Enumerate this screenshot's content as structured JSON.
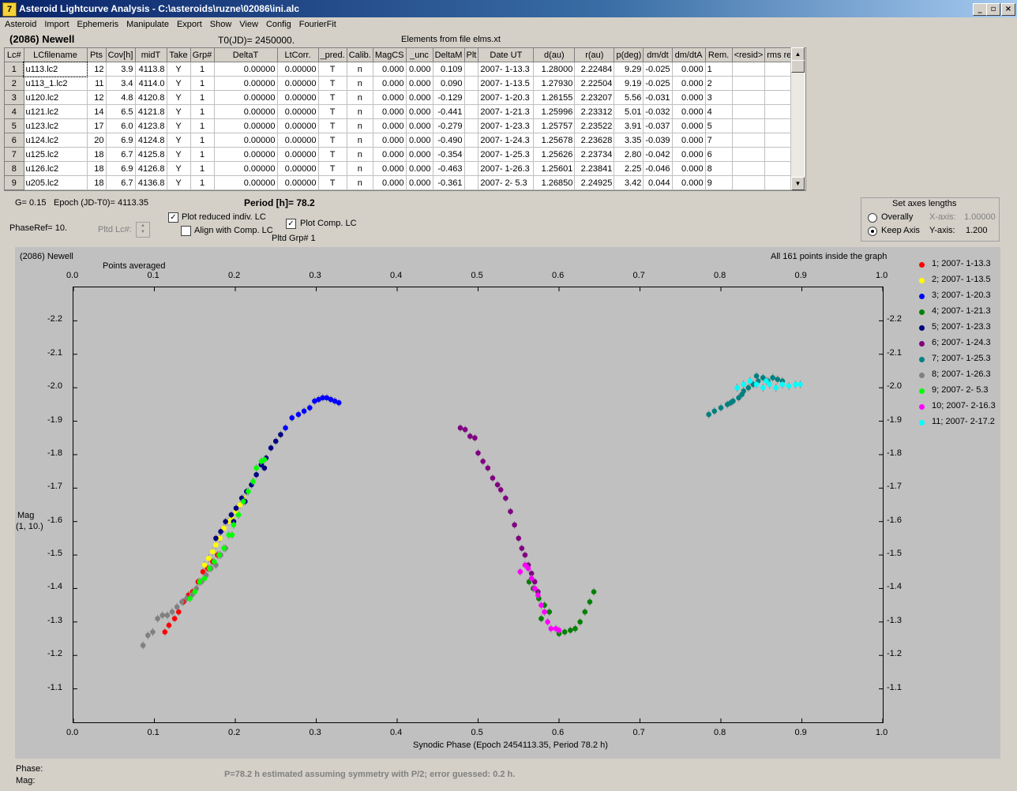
{
  "window": {
    "title": "Asteroid Lightcurve Analysis - C:\\asteroids\\ruzne\\02086\\ini.alc",
    "app_icon": "7",
    "minimize": "_",
    "maximize": "▫",
    "close": "×"
  },
  "menu": [
    "Asteroid",
    "Import",
    "Ephemeris",
    "Manipulate",
    "Export",
    "Show",
    "View",
    "Config",
    "FourierFit"
  ],
  "header": {
    "asteroid": "(2086) Newell",
    "t0": "T0(JD)= 2450000.",
    "elements": "Elements from file elms.xt"
  },
  "table": {
    "columns": [
      "Lc#",
      "LCfilename",
      "Pts",
      "Cov[h]",
      "midT",
      "Take",
      "Grp#",
      "DeltaT",
      "LtCorr.",
      "_pred.",
      "Calib.",
      "MagCS",
      "_unc",
      "DeltaM",
      "Plt",
      "Date UT",
      "d(au)",
      "r(au)",
      "p(deg)",
      "dm/dt",
      "dm/dtA",
      "Rem.",
      "<resid>",
      "rms res"
    ],
    "rows": [
      [
        "1",
        "u113.lc2",
        "12",
        "3.9",
        "4113.8",
        "Y",
        "1",
        "0.00000",
        "0.00000",
        "T",
        "n",
        "0.000",
        "0.000",
        "0.109",
        "",
        "2007- 1-13.3",
        "1.28000",
        "2.22484",
        "9.29",
        "-0.025",
        "0.000",
        "1",
        "",
        ""
      ],
      [
        "2",
        "u113_1.lc2",
        "11",
        "3.4",
        "4114.0",
        "Y",
        "1",
        "0.00000",
        "0.00000",
        "T",
        "n",
        "0.000",
        "0.000",
        "0.090",
        "",
        "2007- 1-13.5",
        "1.27930",
        "2.22504",
        "9.19",
        "-0.025",
        "0.000",
        "2",
        "",
        ""
      ],
      [
        "3",
        "u120.lc2",
        "12",
        "4.8",
        "4120.8",
        "Y",
        "1",
        "0.00000",
        "0.00000",
        "T",
        "n",
        "0.000",
        "0.000",
        "-0.129",
        "",
        "2007- 1-20.3",
        "1.26155",
        "2.23207",
        "5.56",
        "-0.031",
        "0.000",
        "3",
        "",
        ""
      ],
      [
        "4",
        "u121.lc2",
        "14",
        "6.5",
        "4121.8",
        "Y",
        "1",
        "0.00000",
        "0.00000",
        "T",
        "n",
        "0.000",
        "0.000",
        "-0.441",
        "",
        "2007- 1-21.3",
        "1.25996",
        "2.23312",
        "5.01",
        "-0.032",
        "0.000",
        "4",
        "",
        ""
      ],
      [
        "5",
        "u123.lc2",
        "17",
        "6.0",
        "4123.8",
        "Y",
        "1",
        "0.00000",
        "0.00000",
        "T",
        "n",
        "0.000",
        "0.000",
        "-0.279",
        "",
        "2007- 1-23.3",
        "1.25757",
        "2.23522",
        "3.91",
        "-0.037",
        "0.000",
        "5",
        "",
        ""
      ],
      [
        "6",
        "u124.lc2",
        "20",
        "6.9",
        "4124.8",
        "Y",
        "1",
        "0.00000",
        "0.00000",
        "T",
        "n",
        "0.000",
        "0.000",
        "-0.490",
        "",
        "2007- 1-24.3",
        "1.25678",
        "2.23628",
        "3.35",
        "-0.039",
        "0.000",
        "7",
        "",
        ""
      ],
      [
        "7",
        "u125.lc2",
        "18",
        "6.7",
        "4125.8",
        "Y",
        "1",
        "0.00000",
        "0.00000",
        "T",
        "n",
        "0.000",
        "0.000",
        "-0.354",
        "",
        "2007- 1-25.3",
        "1.25626",
        "2.23734",
        "2.80",
        "-0.042",
        "0.000",
        "6",
        "",
        ""
      ],
      [
        "8",
        "u126.lc2",
        "18",
        "6.9",
        "4126.8",
        "Y",
        "1",
        "0.00000",
        "0.00000",
        "T",
        "n",
        "0.000",
        "0.000",
        "-0.463",
        "",
        "2007- 1-26.3",
        "1.25601",
        "2.23841",
        "2.25",
        "-0.046",
        "0.000",
        "8",
        "",
        ""
      ],
      [
        "9",
        "u205.lc2",
        "18",
        "6.7",
        "4136.8",
        "Y",
        "1",
        "0.00000",
        "0.00000",
        "T",
        "n",
        "0.000",
        "0.000",
        "-0.361",
        "",
        "2007- 2- 5.3",
        "1.26850",
        "2.24925",
        "3.42",
        "0.044",
        "0.000",
        "9",
        "",
        ""
      ]
    ]
  },
  "controls": {
    "g": "G= 0.15",
    "epoch": "Epoch (JD-T0)= 4113.35",
    "period": "Period [h]= 78.2",
    "phaseref": "PhaseRef= 10.",
    "pltd_lc": "Pltd Lc#:",
    "plot_reduced": "Plot reduced indiv. LC",
    "align_comp": "Align with Comp. LC",
    "plot_comp": "Plot Comp. LC",
    "pltd_grp": "Pltd Grp#  1",
    "axes_title": "Set axes lengths",
    "overally": "Overally",
    "keep_axis": "Keep Axis",
    "x_axis_label": "X-axis:",
    "x_axis_value": "1.00000",
    "y_axis_label": "Y-axis:",
    "y_axis_value": "1.200",
    "checked": "✓"
  },
  "graph": {
    "title": "(2086) Newell",
    "top_note": "Points averaged",
    "points_note": "All 161 points inside the graph",
    "ylabel_line1": "Mag",
    "ylabel_line2": "(1, 10.)",
    "xlabel": "Synodic Phase (Epoch 2454113.35, Period 78.2 h)"
  },
  "status": {
    "phase": "Phase:",
    "mag": "Mag:",
    "message": "P=78.2 h estimated assuming symmetry with P/2; error guessed: 0.2 h."
  },
  "chart_data": {
    "type": "scatter",
    "xlim": [
      0.0,
      1.0
    ],
    "ylim": [
      -2.3,
      -1.0
    ],
    "y_inverted": true,
    "x_ticks": [
      "0.0",
      "0.1",
      "0.2",
      "0.3",
      "0.4",
      "0.5",
      "0.6",
      "0.7",
      "0.8",
      "0.9",
      "1.0"
    ],
    "y_ticks": [
      "-2.2",
      "-2.1",
      "-2.0",
      "-1.9",
      "-1.8",
      "-1.7",
      "-1.6",
      "-1.5",
      "-1.4",
      "-1.3",
      "-1.2",
      "-1.1"
    ],
    "legend_position": "right",
    "series": [
      {
        "name": "1; 2007- 1-13.3",
        "color": "#ff0000",
        "points": [
          [
            0.113,
            -1.27
          ],
          [
            0.118,
            -1.29
          ],
          [
            0.125,
            -1.31
          ],
          [
            0.13,
            -1.33
          ],
          [
            0.136,
            -1.36
          ],
          [
            0.142,
            -1.38
          ],
          [
            0.147,
            -1.39
          ],
          [
            0.154,
            -1.42
          ],
          [
            0.16,
            -1.45
          ],
          [
            0.166,
            -1.46
          ],
          [
            0.172,
            -1.48
          ],
          [
            0.178,
            -1.5
          ]
        ]
      },
      {
        "name": "2; 2007- 1-13.5",
        "color": "#ffff00",
        "points": [
          [
            0.162,
            -1.47
          ],
          [
            0.167,
            -1.49
          ],
          [
            0.172,
            -1.51
          ],
          [
            0.176,
            -1.53
          ],
          [
            0.181,
            -1.55
          ],
          [
            0.186,
            -1.58
          ],
          [
            0.191,
            -1.6
          ],
          [
            0.196,
            -1.61
          ],
          [
            0.201,
            -1.63
          ],
          [
            0.206,
            -1.65
          ],
          [
            0.21,
            -1.67
          ]
        ]
      },
      {
        "name": "3; 2007- 1-20.3",
        "color": "#0000ff",
        "points": [
          [
            0.262,
            -1.88
          ],
          [
            0.27,
            -1.91
          ],
          [
            0.278,
            -1.92
          ],
          [
            0.285,
            -1.93
          ],
          [
            0.292,
            -1.94
          ],
          [
            0.298,
            -1.96
          ],
          [
            0.303,
            -1.965
          ],
          [
            0.308,
            -1.97
          ],
          [
            0.313,
            -1.97
          ],
          [
            0.318,
            -1.965
          ],
          [
            0.323,
            -1.96
          ],
          [
            0.328,
            -1.955
          ]
        ]
      },
      {
        "name": "4; 2007- 1-21.3",
        "color": "#008000",
        "points": [
          [
            0.6,
            -1.265
          ],
          [
            0.607,
            -1.27
          ],
          [
            0.614,
            -1.275
          ],
          [
            0.62,
            -1.28
          ],
          [
            0.626,
            -1.3
          ],
          [
            0.632,
            -1.33
          ],
          [
            0.638,
            -1.36
          ],
          [
            0.643,
            -1.39
          ],
          [
            0.588,
            -1.33
          ],
          [
            0.582,
            -1.35
          ],
          [
            0.575,
            -1.37
          ],
          [
            0.568,
            -1.4
          ],
          [
            0.563,
            -1.42
          ],
          [
            0.578,
            -1.31
          ]
        ]
      },
      {
        "name": "5; 2007- 1-23.3",
        "color": "#000080",
        "points": [
          [
            0.176,
            -1.55
          ],
          [
            0.182,
            -1.57
          ],
          [
            0.188,
            -1.6
          ],
          [
            0.195,
            -1.62
          ],
          [
            0.201,
            -1.64
          ],
          [
            0.208,
            -1.67
          ],
          [
            0.214,
            -1.69
          ],
          [
            0.22,
            -1.71
          ],
          [
            0.226,
            -1.74
          ],
          [
            0.232,
            -1.77
          ],
          [
            0.238,
            -1.79
          ],
          [
            0.244,
            -1.82
          ],
          [
            0.25,
            -1.84
          ],
          [
            0.256,
            -1.86
          ],
          [
            0.236,
            -1.76
          ],
          [
            0.212,
            -1.66
          ],
          [
            0.198,
            -1.6
          ]
        ]
      },
      {
        "name": "6; 2007- 1-24.3",
        "color": "#800080",
        "points": [
          [
            0.478,
            -1.88
          ],
          [
            0.484,
            -1.875
          ],
          [
            0.49,
            -1.855
          ],
          [
            0.496,
            -1.85
          ],
          [
            0.5,
            -1.805
          ],
          [
            0.506,
            -1.78
          ],
          [
            0.512,
            -1.76
          ],
          [
            0.518,
            -1.73
          ],
          [
            0.524,
            -1.71
          ],
          [
            0.528,
            -1.695
          ],
          [
            0.534,
            -1.67
          ],
          [
            0.54,
            -1.63
          ],
          [
            0.545,
            -1.59
          ],
          [
            0.55,
            -1.55
          ],
          [
            0.554,
            -1.52
          ],
          [
            0.558,
            -1.5
          ],
          [
            0.562,
            -1.47
          ],
          [
            0.566,
            -1.445
          ],
          [
            0.57,
            -1.42
          ],
          [
            0.574,
            -1.39
          ]
        ]
      },
      {
        "name": "7; 2007- 1-25.3",
        "color": "#008080",
        "points": [
          [
            0.785,
            -1.92
          ],
          [
            0.792,
            -1.93
          ],
          [
            0.8,
            -1.94
          ],
          [
            0.808,
            -1.95
          ],
          [
            0.815,
            -1.96
          ],
          [
            0.822,
            -1.97
          ],
          [
            0.828,
            -1.99
          ],
          [
            0.834,
            -2.0
          ],
          [
            0.84,
            -2.01
          ],
          [
            0.846,
            -2.02
          ],
          [
            0.852,
            -2.03
          ],
          [
            0.858,
            -2.02
          ],
          [
            0.864,
            -2.03
          ],
          [
            0.87,
            -2.025
          ],
          [
            0.876,
            -2.02
          ],
          [
            0.844,
            -2.035
          ],
          [
            0.826,
            -1.98
          ],
          [
            0.812,
            -1.955
          ]
        ]
      },
      {
        "name": "8; 2007- 1-26.3",
        "color": "#808080",
        "points": [
          [
            0.086,
            -1.23
          ],
          [
            0.092,
            -1.26
          ],
          [
            0.098,
            -1.27
          ],
          [
            0.104,
            -1.31
          ],
          [
            0.11,
            -1.32
          ],
          [
            0.116,
            -1.32
          ],
          [
            0.122,
            -1.33
          ],
          [
            0.128,
            -1.345
          ],
          [
            0.134,
            -1.36
          ],
          [
            0.14,
            -1.37
          ],
          [
            0.146,
            -1.38
          ],
          [
            0.152,
            -1.4
          ],
          [
            0.158,
            -1.42
          ],
          [
            0.164,
            -1.44
          ],
          [
            0.17,
            -1.46
          ],
          [
            0.176,
            -1.47
          ],
          [
            0.182,
            -1.5
          ],
          [
            0.188,
            -1.52
          ]
        ]
      },
      {
        "name": "9; 2007- 2- 5.3",
        "color": "#00ff00",
        "points": [
          [
            0.144,
            -1.37
          ],
          [
            0.15,
            -1.39
          ],
          [
            0.156,
            -1.42
          ],
          [
            0.162,
            -1.43
          ],
          [
            0.168,
            -1.46
          ],
          [
            0.174,
            -1.48
          ],
          [
            0.18,
            -1.5
          ],
          [
            0.186,
            -1.52
          ],
          [
            0.192,
            -1.56
          ],
          [
            0.198,
            -1.59
          ],
          [
            0.204,
            -1.62
          ],
          [
            0.21,
            -1.66
          ],
          [
            0.216,
            -1.69
          ],
          [
            0.222,
            -1.72
          ],
          [
            0.226,
            -1.76
          ],
          [
            0.232,
            -1.78
          ],
          [
            0.236,
            -1.785
          ],
          [
            0.196,
            -1.56
          ]
        ]
      },
      {
        "name": "10; 2007- 2-16.3",
        "color": "#ff00ff",
        "points": [
          [
            0.552,
            -1.45
          ],
          [
            0.558,
            -1.47
          ],
          [
            0.562,
            -1.46
          ],
          [
            0.566,
            -1.43
          ],
          [
            0.57,
            -1.4
          ],
          [
            0.574,
            -1.38
          ],
          [
            0.578,
            -1.35
          ],
          [
            0.582,
            -1.33
          ],
          [
            0.586,
            -1.3
          ],
          [
            0.59,
            -1.28
          ],
          [
            0.596,
            -1.28
          ],
          [
            0.6,
            -1.275
          ]
        ]
      },
      {
        "name": "11; 2007- 2-17.2",
        "color": "#00ffff",
        "points": [
          [
            0.82,
            -2.0
          ],
          [
            0.828,
            -2.01
          ],
          [
            0.836,
            -2.02
          ],
          [
            0.844,
            -2.01
          ],
          [
            0.852,
            -2.0
          ],
          [
            0.86,
            -2.01
          ],
          [
            0.868,
            -2.0
          ],
          [
            0.876,
            -2.01
          ],
          [
            0.884,
            -2.005
          ],
          [
            0.892,
            -2.01
          ],
          [
            0.898,
            -2.01
          ],
          [
            0.856,
            -2.02
          ]
        ]
      }
    ]
  }
}
